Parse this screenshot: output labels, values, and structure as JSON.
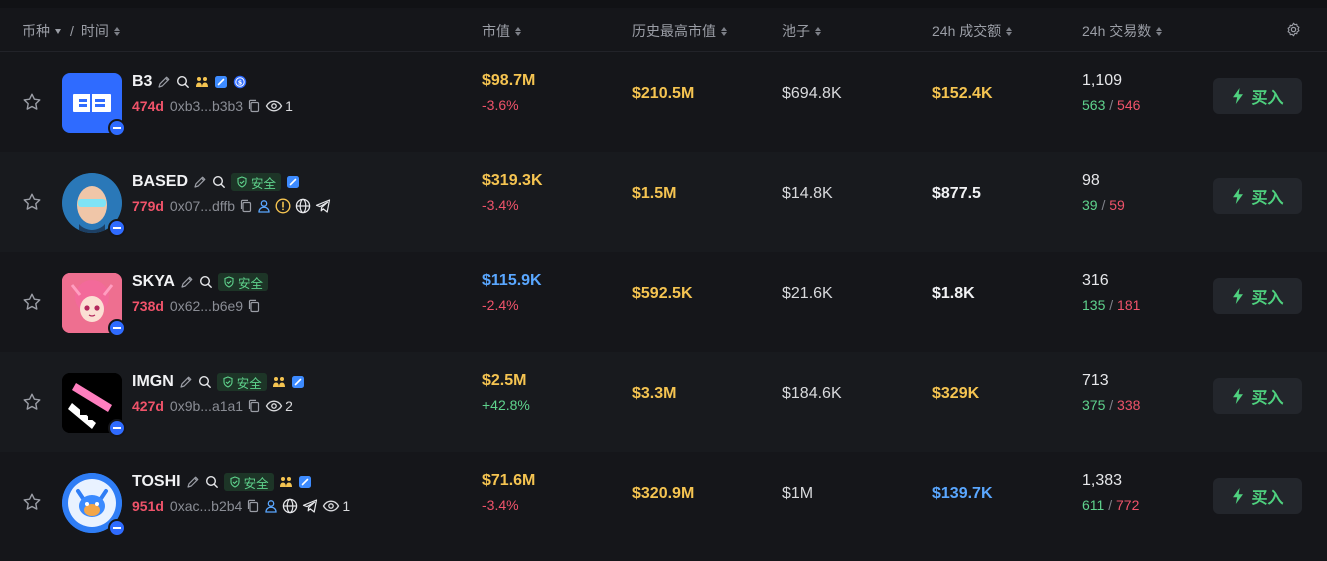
{
  "header": {
    "coin": "币种",
    "slash": "/",
    "time": "时间",
    "mcap": "市值",
    "ath": "历史最高市值",
    "pool": "池子",
    "vol24": "24h 成交额",
    "tx24": "24h 交易数"
  },
  "buy_label": "买入",
  "safe_label": "安全",
  "rows": [
    {
      "name": "B3",
      "age": "474d",
      "address": "0xb3...b3b3",
      "watchers": "1",
      "mcap": "$98.7M",
      "change": "-3.6%",
      "ath": "$210.5M",
      "pool": "$694.8K",
      "vol": "$152.4K",
      "txs": "1,109",
      "buys": "563",
      "sells": "546"
    },
    {
      "name": "BASED",
      "age": "779d",
      "address": "0x07...dffb",
      "mcap": "$319.3K",
      "change": "-3.4%",
      "ath": "$1.5M",
      "pool": "$14.8K",
      "vol": "$877.5",
      "txs": "98",
      "buys": "39",
      "sells": "59"
    },
    {
      "name": "SKYA",
      "age": "738d",
      "address": "0x62...b6e9",
      "mcap": "$115.9K",
      "change": "-2.4%",
      "ath": "$592.5K",
      "pool": "$21.6K",
      "vol": "$1.8K",
      "txs": "316",
      "buys": "135",
      "sells": "181"
    },
    {
      "name": "IMGN",
      "age": "427d",
      "address": "0x9b...a1a1",
      "watchers": "2",
      "mcap": "$2.5M",
      "change": "+42.8%",
      "ath": "$3.3M",
      "pool": "$184.6K",
      "vol": "$329K",
      "txs": "713",
      "buys": "375",
      "sells": "338"
    },
    {
      "name": "TOSHI",
      "age": "951d",
      "address": "0xac...b2b4",
      "watchers": "1",
      "mcap": "$71.6M",
      "change": "-3.4%",
      "ath": "$320.9M",
      "pool": "$1M",
      "vol": "$139.7K",
      "txs": "1,383",
      "buys": "611",
      "sells": "772"
    }
  ],
  "colors": {
    "yellow": "#f5c451",
    "blue": "#5aa7ff",
    "green": "#5fd38d",
    "red": "#f0536a",
    "background": "#15161a"
  },
  "icons": [
    "star-icon",
    "edit-icon",
    "search-icon",
    "holders-icon",
    "verified-icon",
    "shield-icon",
    "copy-icon",
    "eye-icon",
    "user-icon",
    "warning-icon",
    "globe-icon",
    "telegram-icon",
    "lightning-icon",
    "gear-icon"
  ]
}
